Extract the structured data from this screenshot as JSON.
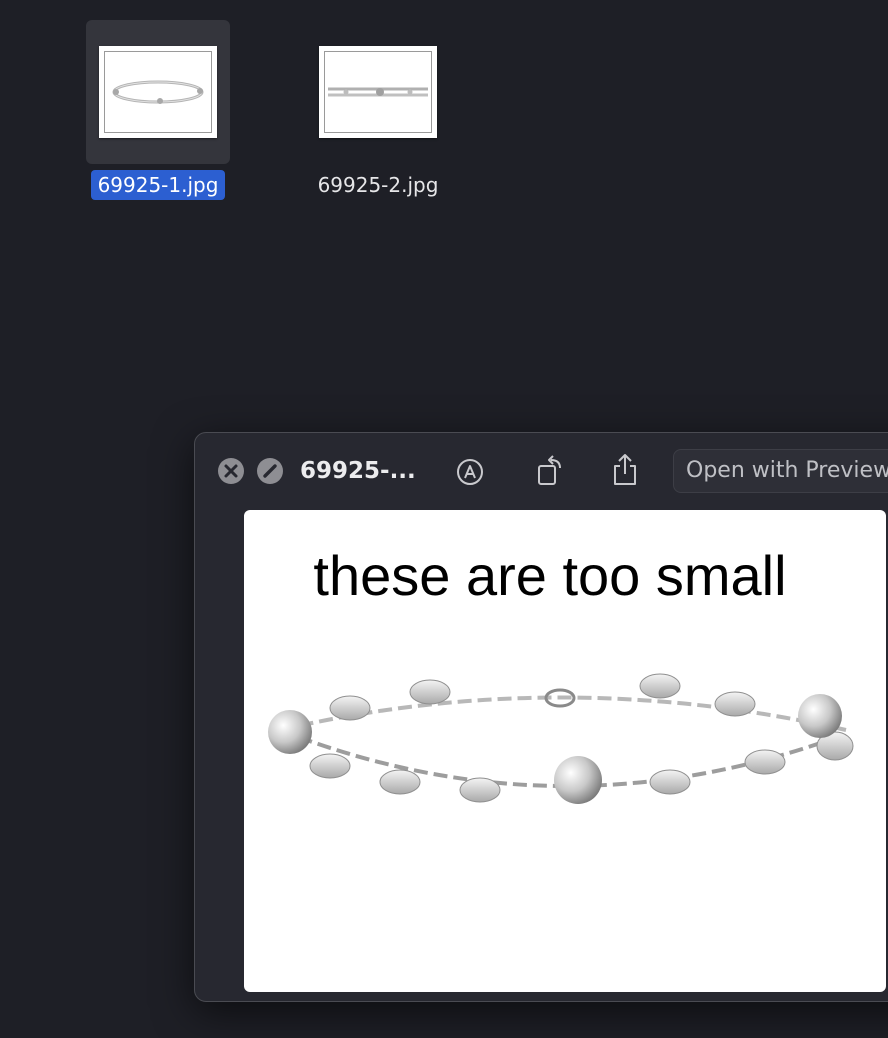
{
  "desktop": {
    "files": [
      {
        "name": "69925-1.jpg",
        "selected": true
      },
      {
        "name": "69925-2.jpg",
        "selected": false
      }
    ],
    "colors": {
      "background": "#1e1f26",
      "selection": "#2c5fd1"
    }
  },
  "quicklook": {
    "title": "69925-...",
    "open_with_label": "Open with Preview",
    "toolbar_icons": [
      "close-icon",
      "full-screen-icon",
      "markup-icon",
      "rotate-icon",
      "share-icon"
    ],
    "image_caption": "these are too small"
  }
}
